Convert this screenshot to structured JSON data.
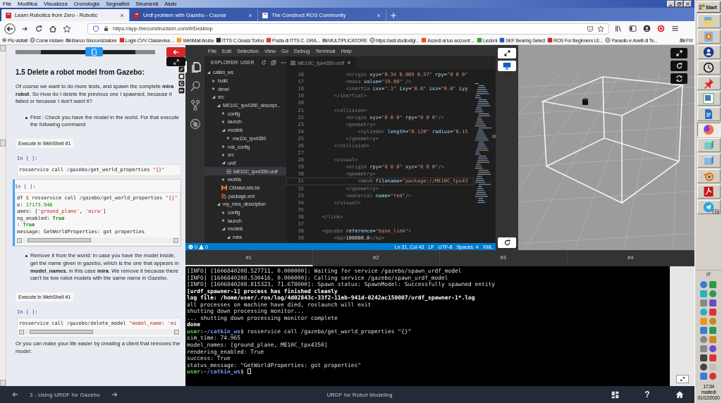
{
  "browser": {
    "menu": [
      "File",
      "Modifica",
      "Visualizza",
      "Cronologia",
      "Segnalibri",
      "Strumenti",
      "Aiuto"
    ],
    "tabs": [
      {
        "title": "Learn Robotics from Zero - Robotic",
        "selected": true
      },
      {
        "title": "Urdf problem with Gazebo - Course",
        "selected": false
      },
      {
        "title": "The Construct ROS Community",
        "selected": false
      }
    ],
    "url": "https://app.theconstructsim.com/#/Desktop",
    "bookmarks": [
      {
        "label": "Più visitati",
        "kind": "gear"
      },
      {
        "label": "Come iniziare",
        "kind": "globe"
      },
      {
        "label": "Banco Sincronizzatore",
        "kind": "folder"
      },
      {
        "label": "Login CVV Classeviva ...",
        "kind": "site",
        "color": "#d9342b"
      },
      {
        "label": "WebMail Aruba",
        "kind": "site",
        "color": "#f0a030"
      },
      {
        "label": "ITTS C.Grassi Torino",
        "kind": "site",
        "color": "#333333"
      },
      {
        "label": "Posta di ITTS C. GRA...",
        "kind": "site",
        "color": "#d44638"
      },
      {
        "label": "MULTIPLICATORE",
        "kind": "folder"
      },
      {
        "label": "https://asit.studiodigi...",
        "kind": "globe"
      },
      {
        "label": "Accedi al tuo account ...",
        "kind": "site",
        "color": "#f25022"
      },
      {
        "label": "Lezioni",
        "kind": "site",
        "color": "#3a9a3a"
      },
      {
        "label": "SKF Bearing Select",
        "kind": "site",
        "color": "#1a5fb4"
      },
      {
        "label": "ROS For Beginners LE...",
        "kind": "site",
        "color": "#c62828"
      },
      {
        "label": "Paraolio e Anelli di Te...",
        "kind": "globe"
      },
      {
        "label": "FIX",
        "kind": "folder"
      }
    ]
  },
  "notebook": {
    "blocks": [
      {
        "kind": "heading",
        "text": "1.5 Delete a robot model from Gazebo:"
      },
      {
        "kind": "para",
        "text": "Of course we want to do more tests, and spawn the complete **mira robot**. So How do I delete the previous one I spawned, because it failed or because I don't want it?"
      },
      {
        "kind": "bullet",
        "text": "First : Check you have the model in the world. For that execute the following command:"
      },
      {
        "kind": "button",
        "text": "Execute in WebShell #1"
      },
      {
        "kind": "cell",
        "prompt": "In [ ]:",
        "selected": false,
        "scrollbar": false,
        "lines": [
          "rosservice call /gazebo/get_world_properties \"{}\""
        ]
      },
      {
        "kind": "cell",
        "prompt": "In [ ]:",
        "selected": true,
        "scrollbar": true,
        "lines": [
          "df $ rosservice call /gazebo/get_world_properties \"{}\"",
          "e: 17173.946",
          "ames: ['ground_plane', 'mira']",
          "ng_enabled: True",
          ": True",
          "message: GetWorldProperties: got properties"
        ]
      },
      {
        "kind": "bullet",
        "text": "Remove it from the world: In case you have the model inside, get the name given in gazebo, which is the one that appears in **model_names**, in this case **mira**. We remove it because there can't be tow robot models with the same name in Gazebo."
      },
      {
        "kind": "button",
        "text": "Execute in WebShell #1"
      },
      {
        "kind": "cell",
        "prompt": "In [ ]:",
        "selected": false,
        "scrollbar": true,
        "lines": [
          "rosservice call /gazebo/delete_model \"model_name: 'mi"
        ]
      },
      {
        "kind": "para",
        "text": "Or you can make your life easier by creating a client that removes the model:"
      }
    ]
  },
  "editor": {
    "menu": [
      "File",
      "Edit",
      "Selection",
      "View",
      "Go",
      "Debug",
      "Terminal",
      "Help"
    ],
    "explorer_title": "EXPLORER: USER",
    "tree": [
      {
        "label": "catkin_ws",
        "kind": "folder",
        "expanded": true,
        "selected": false,
        "children": [
          {
            "label": "build",
            "kind": "folder",
            "expanded": false,
            "selected": false
          },
          {
            "label": "devel",
            "kind": "folder",
            "expanded": false,
            "selected": false
          },
          {
            "label": "src",
            "kind": "folder",
            "expanded": true,
            "selected": false,
            "children": [
              {
                "label": "ME10C_tpx4350_descript...",
                "kind": "folder",
                "expanded": true,
                "selected": false,
                "children": [
                  {
                    "label": "config",
                    "kind": "folder",
                    "expanded": false,
                    "selected": false
                  },
                  {
                    "label": "launch",
                    "kind": "folder",
                    "expanded": false,
                    "selected": false
                  },
                  {
                    "label": "models",
                    "kind": "folder",
                    "expanded": true,
                    "selected": false,
                    "children": [
                      {
                        "label": "me10c_tpx4350",
                        "kind": "folder",
                        "expanded": false,
                        "selected": false
                      }
                    ]
                  },
                  {
                    "label": "rviz_config",
                    "kind": "folder",
                    "expanded": false,
                    "selected": false
                  },
                  {
                    "label": "src",
                    "kind": "folder",
                    "expanded": false,
                    "selected": false
                  },
                  {
                    "label": "urdf",
                    "kind": "folder",
                    "expanded": true,
                    "selected": false,
                    "children": [
                      {
                        "label": "ME10C_tpx4350.urdf",
                        "kind": "urdf",
                        "selected": true
                      }
                    ]
                  },
                  {
                    "label": "worlds",
                    "kind": "folder",
                    "expanded": false,
                    "selected": false
                  },
                  {
                    "label": "CMakeLists.txt",
                    "kind": "cmake",
                    "selected": false
                  },
                  {
                    "label": "package.xml",
                    "kind": "xml",
                    "selected": false
                  }
                ]
              },
              {
                "label": "my_mira_description",
                "kind": "folder",
                "expanded": true,
                "selected": false,
                "children": [
                  {
                    "label": "config",
                    "kind": "folder",
                    "expanded": false,
                    "selected": false
                  },
                  {
                    "label": "launch",
                    "kind": "folder",
                    "expanded": false,
                    "selected": false
                  },
                  {
                    "label": "models",
                    "kind": "folder",
                    "expanded": true,
                    "selected": false,
                    "children": [
                      {
                        "label": "mira",
                        "kind": "folder",
                        "expanded": true,
                        "selected": false
                      }
                    ]
                  }
                ]
              }
            ]
          }
        ]
      }
    ],
    "tab": "ME10C_tpx4350.urdf",
    "lines": [
      {
        "n": "16",
        "code": "            <origin xyz=\"0.34 0.009 0.57\" rpy=\"0 0 0\"",
        "current": false
      },
      {
        "n": "17",
        "code": "            <mass value=\"19.80\" />",
        "current": false
      },
      {
        "n": "18",
        "code": "            <inertia ixx=\".1\" ixy=\"0.0\" ixz=\"0.0\" iyy",
        "current": false
      },
      {
        "n": "19",
        "code": "        </inertial>",
        "current": false
      },
      {
        "n": "20",
        "current": false
      },
      {
        "n": "21",
        "code": "        <collision>",
        "current": false
      },
      {
        "n": "22",
        "code": "            <origin xyz=\"0 0 0\" rpy=\"0 0 0\"/>",
        "current": false
      },
      {
        "n": "23",
        "code": "            <geometry>",
        "current": false
      },
      {
        "n": "24",
        "code": "                <cylinder length=\"0.120\" radius=\"0.15",
        "current": false
      },
      {
        "n": "25",
        "code": "            </geometry>",
        "current": false
      },
      {
        "n": "26",
        "code": "        </collision>",
        "current": false
      },
      {
        "n": "27",
        "current": false
      },
      {
        "n": "28",
        "code": "        <visual>",
        "current": false
      },
      {
        "n": "29",
        "code": "            <origin rpy=\"0 0 0\" xyz=\"0 0 0\"/>",
        "current": false
      },
      {
        "n": "30",
        "code": "            <geometry>",
        "current": false
      },
      {
        "n": "31",
        "code": "                <mesh filename=\"package://ME10C_tpx43",
        "current": true
      },
      {
        "n": "32",
        "code": "            </geometry>",
        "current": false
      },
      {
        "n": "33",
        "code": "            <material name=\"red\"/>",
        "current": false
      },
      {
        "n": "34",
        "code": "        </visual>",
        "current": false
      },
      {
        "n": "35",
        "current": false
      },
      {
        "n": "36",
        "code": "    </link>",
        "current": false
      },
      {
        "n": "37",
        "current": false
      },
      {
        "n": "38",
        "code": "    <gazebo reference=\"base_link\">",
        "current": false
      },
      {
        "n": "39",
        "code": "        <kp>100000.0</kp>",
        "current": false
      }
    ],
    "status": {
      "errors": "0",
      "warnings": "0",
      "position": "Ln 31, Col 43",
      "eol": "LF",
      "encoding": "UTF-8",
      "indent": "Spaces: 4",
      "language": "XML"
    }
  },
  "terminal": {
    "tabs": [
      {
        "label": "#1",
        "selected": true
      },
      {
        "label": "#2",
        "selected": false
      },
      {
        "label": "#3",
        "selected": false
      },
      {
        "label": "#4",
        "selected": false
      }
    ],
    "lines": [
      {
        "kind": "text",
        "text": "[INFO] [1606840208.527711, 0.000000]: Waiting for service /gazebo/spawn_urdf_model"
      },
      {
        "kind": "text",
        "text": "[INFO] [1606840208.530416, 0.000000]: Calling service /gazebo/spawn_urdf_model"
      },
      {
        "kind": "text",
        "text": "[INFO] [1606840208.815323, 71.678000]: Spawn status: SpawnModel: Successfully spawned entity"
      },
      {
        "kind": "bold",
        "text": "[urdf_spawner-1] process has finished cleanly"
      },
      {
        "kind": "bold",
        "text": "log file: /home/user/.ros/log/4d02843c-33f2-11eb-941d-0242ac150007/urdf_spawner-1*.log"
      },
      {
        "kind": "text",
        "text": "all processes on machine have died, roslaunch will exit"
      },
      {
        "kind": "text",
        "text": "shutting down processing monitor..."
      },
      {
        "kind": "text",
        "text": "... shutting down processing monitor complete"
      },
      {
        "kind": "bold",
        "text": "done"
      },
      {
        "kind": "prompt",
        "host": "user:",
        "path": "~/catkin_ws",
        "sign": "$",
        "cmd": "rosservice call /gazebo/get_world_properties \"{}\"",
        "cursor": false
      },
      {
        "kind": "text",
        "text": "sim_time: 74.965"
      },
      {
        "kind": "text",
        "text": "model_names: [ground_plane, ME10C_tpx4350]"
      },
      {
        "kind": "text",
        "text": "rendering_enabled: True"
      },
      {
        "kind": "text",
        "text": "success: True"
      },
      {
        "kind": "text",
        "text": "status_message: \"GetWorldProperties: got properties\""
      },
      {
        "kind": "prompt",
        "host": "user:",
        "path": "~/catkin_ws",
        "sign": "$",
        "cursor": true
      }
    ]
  },
  "course_bar": {
    "chapter": "3 - Using URDF for Gazebo",
    "title": "URDF for Robot Modeling",
    "help": "?"
  },
  "taskbar": {
    "start": "Start",
    "apps": [
      {
        "selected": false
      },
      {
        "selected": false
      },
      {
        "selected": false
      },
      {
        "selected": false
      },
      {
        "selected": false
      },
      {
        "selected": false
      },
      {
        "selected": false
      },
      {
        "selected": true
      },
      {
        "selected": false
      },
      {
        "selected": false
      },
      {
        "selected": false
      },
      {
        "selected": false
      },
      {
        "selected": false,
        "badge": "47"
      }
    ],
    "language": "IT",
    "clock": [
      "17:34",
      "martedì",
      "01/12/2020"
    ]
  }
}
